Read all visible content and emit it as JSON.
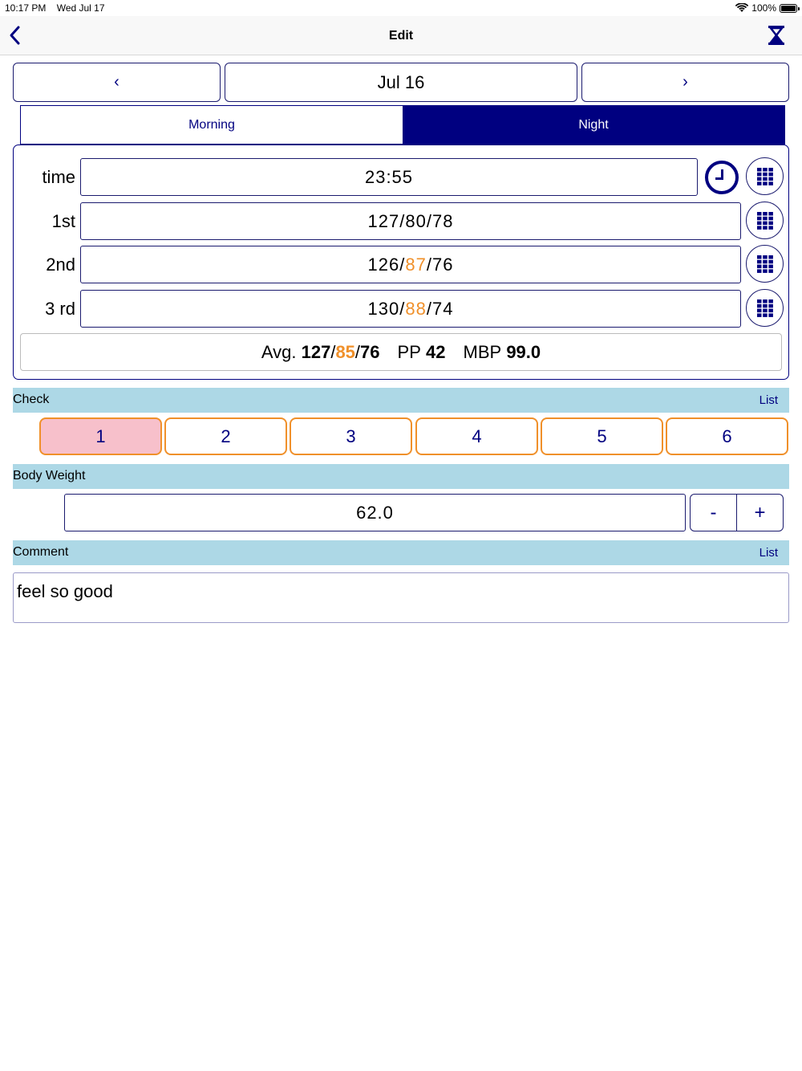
{
  "status_bar": {
    "time": "10:17 PM",
    "date": "Wed Jul 17",
    "battery": "100%"
  },
  "nav": {
    "title": "Edit",
    "back_icon": "chevron-left-icon",
    "action_icon": "hourglass-icon"
  },
  "date_nav": {
    "label": "Jul 16",
    "prev": "‹",
    "next": "›"
  },
  "segments": {
    "morning": "Morning",
    "night": "Night",
    "selected": "Night"
  },
  "readings": {
    "time": {
      "label": "time",
      "value": "23:55"
    },
    "first": {
      "label": "1st",
      "sys": "127",
      "dia": "80",
      "pulse": "78"
    },
    "second": {
      "label": "2nd",
      "sys": "126",
      "dia": "87",
      "pulse": "76"
    },
    "third": {
      "label": "3 rd",
      "sys": "130",
      "dia": "88",
      "pulse": "74"
    }
  },
  "summary": {
    "avg_label": "Avg.",
    "avg_sys": "127",
    "avg_dia": "85",
    "avg_pulse": "76",
    "pp_label": "PP",
    "pp_value": "42",
    "mbp_label": "MBP",
    "mbp_value": "99.0"
  },
  "check": {
    "title": "Check",
    "list_label": "List",
    "options": [
      "1",
      "2",
      "3",
      "4",
      "5",
      "6"
    ],
    "selected": "1"
  },
  "body_weight": {
    "title": "Body Weight",
    "value": "62.0",
    "minus": "-",
    "plus": "+"
  },
  "comment": {
    "title": "Comment",
    "list_label": "List",
    "value": "feel so good"
  },
  "colors": {
    "navy": "#000080",
    "orange": "#f0902a",
    "section_bg": "#add8e6",
    "selected_check": "#f7c0cb"
  }
}
